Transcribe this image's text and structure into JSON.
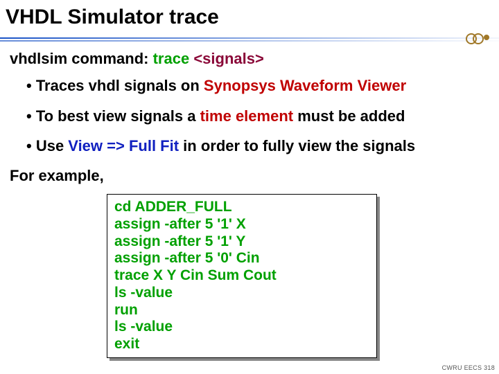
{
  "title": "VHDL Simulator trace",
  "command": {
    "prefix": "vhdlsim command: ",
    "cmd": "trace ",
    "args": "<signals>"
  },
  "bullets": [
    {
      "lead": "• Traces vhdl signals on ",
      "hi": "Synopsys Waveform Viewer",
      "tail": ""
    },
    {
      "lead": "• To best view signals a ",
      "hi": "time element",
      "tail": " must be added"
    },
    {
      "lead": "• Use ",
      "hi": "View => Full Fit",
      "tail": " in order to fully view the signals"
    }
  ],
  "for_example": "For example,",
  "example_lines": [
    "cd ADDER_FULL",
    "assign -after 5 '1' X",
    "assign -after 5 '1' Y",
    "assign -after 5 '0' Cin",
    "trace X Y Cin Sum Cout",
    "ls -value",
    "run",
    "ls -value",
    "exit"
  ],
  "footer": "CWRU EECS 318"
}
